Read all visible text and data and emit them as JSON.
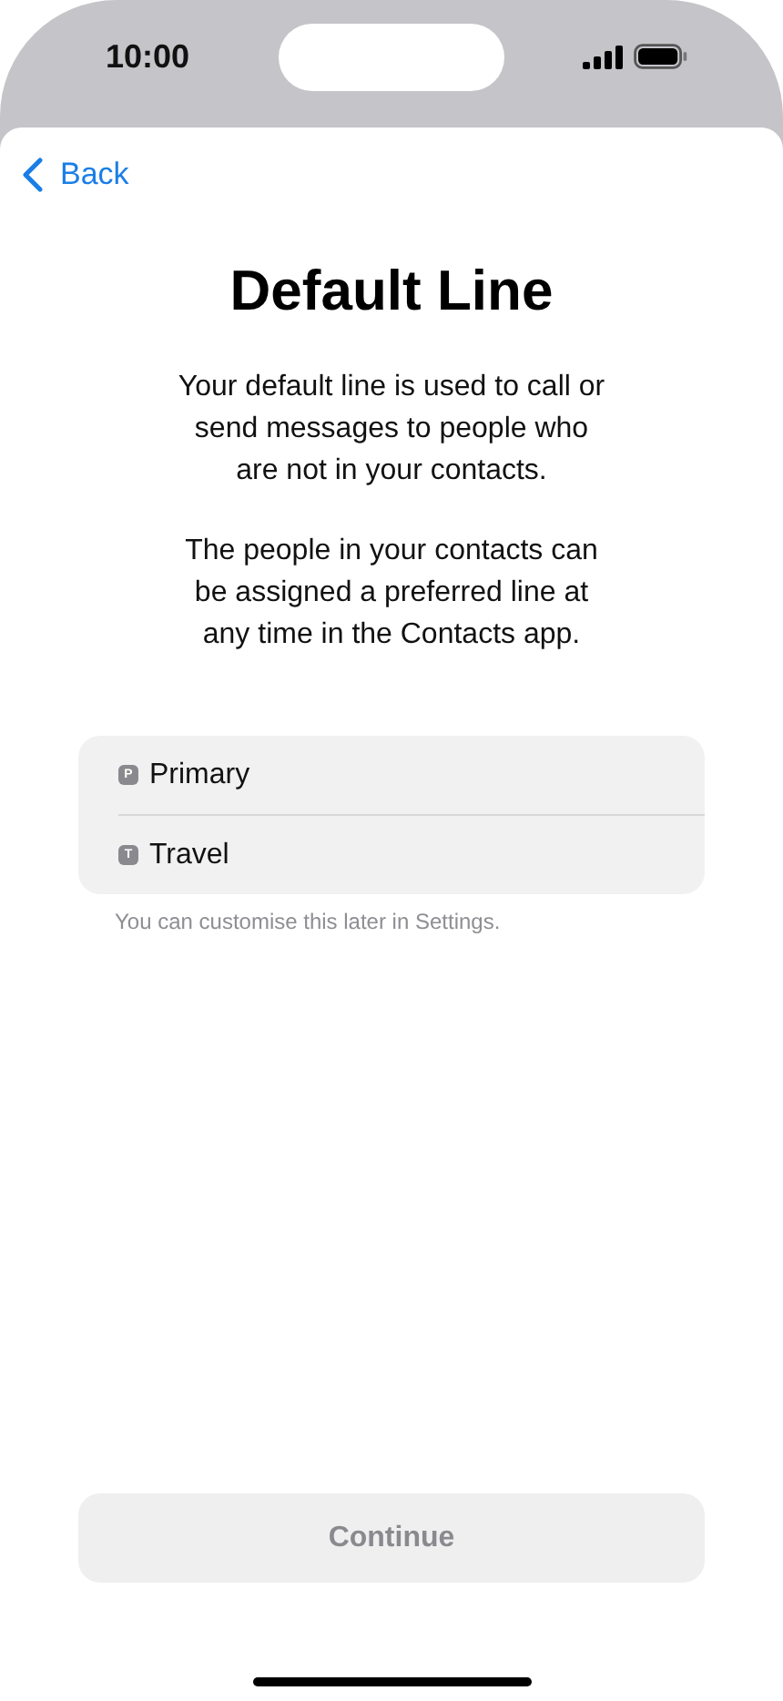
{
  "status_bar": {
    "time": "10:00"
  },
  "nav": {
    "back": "Back"
  },
  "title": "Default Line",
  "paragraphs": [
    "Your default line is used to call or send messages to people who are not in your contacts.",
    "The people in your contacts can be assigned a preferred line at any time in the Contacts app."
  ],
  "lines": [
    {
      "badge": "P",
      "label": "Primary"
    },
    {
      "badge": "T",
      "label": "Travel"
    }
  ],
  "footnote": "You can customise this later in Settings.",
  "continue_button": {
    "label": "Continue",
    "disabled": true
  }
}
